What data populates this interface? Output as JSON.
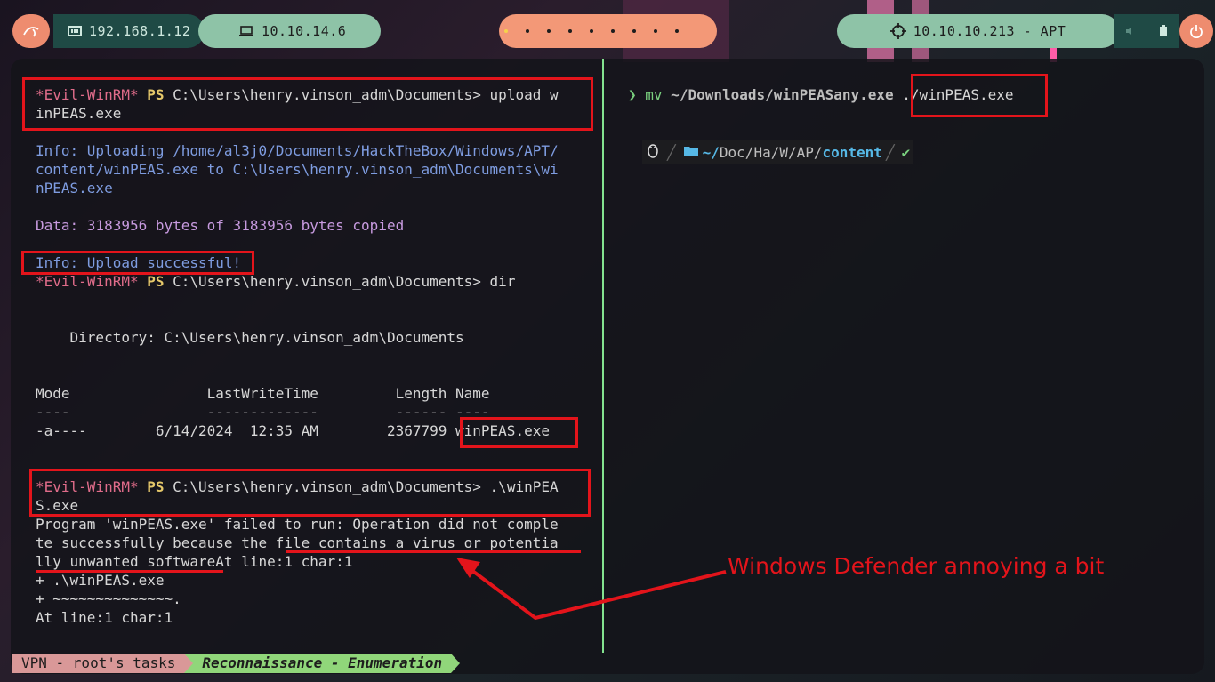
{
  "topbar": {
    "lan_ip": "192.168.1.12",
    "vpn_ip": "10.10.14.6",
    "target": "10.10.10.213 - APT"
  },
  "left_pane": {
    "l1_prefix": "*Evil-WinRM*",
    "l1_ps": "PS",
    "l1_cmd": " C:\\Users\\henry.vinson_adm\\Documents> upload w",
    "l2": "inPEAS.exe",
    "l3": "Info: Uploading /home/al3j0/Documents/HackTheBox/Windows/APT/",
    "l4": "content/winPEAS.exe to C:\\Users\\henry.vinson_adm\\Documents\\wi",
    "l5": "nPEAS.exe",
    "l6": "Data: 3183956 bytes of 3183956 bytes copied",
    "l7": "Info: Upload successful!",
    "l8_prefix": "*Evil-WinRM*",
    "l8_ps": "PS",
    "l8_cmd": " C:\\Users\\henry.vinson_adm\\Documents> dir",
    "l9": "    Directory: C:\\Users\\henry.vinson_adm\\Documents",
    "l10": "Mode                LastWriteTime         Length Name",
    "l11": "----                -------------         ------ ----",
    "l12": "-a----        6/14/2024  12:35 AM        2367799 winPEAS.exe",
    "l13_prefix": "*Evil-WinRM*",
    "l13_ps": "PS",
    "l13_cmd": " C:\\Users\\henry.vinson_adm\\Documents> .\\winPEA",
    "l14": "S.exe",
    "l15": "Program 'winPEAS.exe' failed to run: Operation did not comple",
    "l16": "te successfully because the file contains a virus or potentia",
    "l17": "lly unwanted softwareAt line:1 char:1",
    "l18": "+ .\\winPEAS.exe",
    "l19": "+ ~~~~~~~~~~~~~~.",
    "l20": "At line:1 char:1"
  },
  "right_pane": {
    "arrow": "❯",
    "cmd": "mv",
    "arg1": " ~/Downloads/winPEASany.exe ",
    "arg2": "./winPEAS.exe",
    "prompt_path_home": "~/",
    "prompt_path_rest": "Doc/Ha/W/AP/",
    "prompt_path_last": "content",
    "prompt_ok": "✔"
  },
  "annotation": "Windows Defender annoying a bit",
  "statusbar": {
    "session": "VPN - root's tasks",
    "window": "Reconnaissance - Enumeration"
  }
}
